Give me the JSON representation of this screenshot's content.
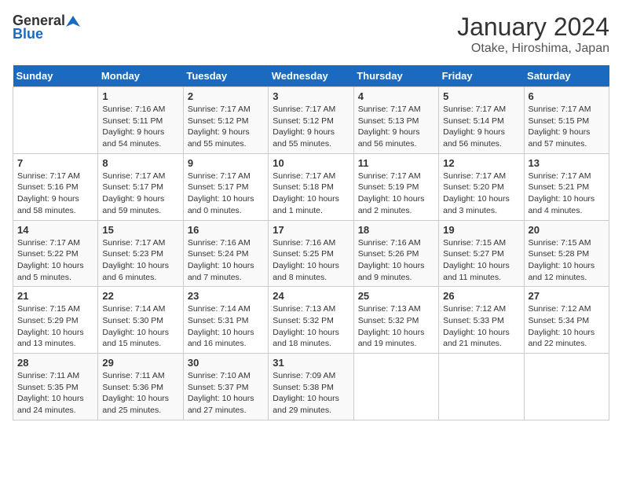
{
  "logo": {
    "general": "General",
    "blue": "Blue"
  },
  "header": {
    "month": "January 2024",
    "location": "Otake, Hiroshima, Japan"
  },
  "days_of_week": [
    "Sunday",
    "Monday",
    "Tuesday",
    "Wednesday",
    "Thursday",
    "Friday",
    "Saturday"
  ],
  "weeks": [
    [
      {
        "day": "",
        "info": ""
      },
      {
        "day": "1",
        "info": "Sunrise: 7:16 AM\nSunset: 5:11 PM\nDaylight: 9 hours\nand 54 minutes."
      },
      {
        "day": "2",
        "info": "Sunrise: 7:17 AM\nSunset: 5:12 PM\nDaylight: 9 hours\nand 55 minutes."
      },
      {
        "day": "3",
        "info": "Sunrise: 7:17 AM\nSunset: 5:12 PM\nDaylight: 9 hours\nand 55 minutes."
      },
      {
        "day": "4",
        "info": "Sunrise: 7:17 AM\nSunset: 5:13 PM\nDaylight: 9 hours\nand 56 minutes."
      },
      {
        "day": "5",
        "info": "Sunrise: 7:17 AM\nSunset: 5:14 PM\nDaylight: 9 hours\nand 56 minutes."
      },
      {
        "day": "6",
        "info": "Sunrise: 7:17 AM\nSunset: 5:15 PM\nDaylight: 9 hours\nand 57 minutes."
      }
    ],
    [
      {
        "day": "7",
        "info": "Sunrise: 7:17 AM\nSunset: 5:16 PM\nDaylight: 9 hours\nand 58 minutes."
      },
      {
        "day": "8",
        "info": "Sunrise: 7:17 AM\nSunset: 5:17 PM\nDaylight: 9 hours\nand 59 minutes."
      },
      {
        "day": "9",
        "info": "Sunrise: 7:17 AM\nSunset: 5:17 PM\nDaylight: 10 hours\nand 0 minutes."
      },
      {
        "day": "10",
        "info": "Sunrise: 7:17 AM\nSunset: 5:18 PM\nDaylight: 10 hours\nand 1 minute."
      },
      {
        "day": "11",
        "info": "Sunrise: 7:17 AM\nSunset: 5:19 PM\nDaylight: 10 hours\nand 2 minutes."
      },
      {
        "day": "12",
        "info": "Sunrise: 7:17 AM\nSunset: 5:20 PM\nDaylight: 10 hours\nand 3 minutes."
      },
      {
        "day": "13",
        "info": "Sunrise: 7:17 AM\nSunset: 5:21 PM\nDaylight: 10 hours\nand 4 minutes."
      }
    ],
    [
      {
        "day": "14",
        "info": "Sunrise: 7:17 AM\nSunset: 5:22 PM\nDaylight: 10 hours\nand 5 minutes."
      },
      {
        "day": "15",
        "info": "Sunrise: 7:17 AM\nSunset: 5:23 PM\nDaylight: 10 hours\nand 6 minutes."
      },
      {
        "day": "16",
        "info": "Sunrise: 7:16 AM\nSunset: 5:24 PM\nDaylight: 10 hours\nand 7 minutes."
      },
      {
        "day": "17",
        "info": "Sunrise: 7:16 AM\nSunset: 5:25 PM\nDaylight: 10 hours\nand 8 minutes."
      },
      {
        "day": "18",
        "info": "Sunrise: 7:16 AM\nSunset: 5:26 PM\nDaylight: 10 hours\nand 9 minutes."
      },
      {
        "day": "19",
        "info": "Sunrise: 7:15 AM\nSunset: 5:27 PM\nDaylight: 10 hours\nand 11 minutes."
      },
      {
        "day": "20",
        "info": "Sunrise: 7:15 AM\nSunset: 5:28 PM\nDaylight: 10 hours\nand 12 minutes."
      }
    ],
    [
      {
        "day": "21",
        "info": "Sunrise: 7:15 AM\nSunset: 5:29 PM\nDaylight: 10 hours\nand 13 minutes."
      },
      {
        "day": "22",
        "info": "Sunrise: 7:14 AM\nSunset: 5:30 PM\nDaylight: 10 hours\nand 15 minutes."
      },
      {
        "day": "23",
        "info": "Sunrise: 7:14 AM\nSunset: 5:31 PM\nDaylight: 10 hours\nand 16 minutes."
      },
      {
        "day": "24",
        "info": "Sunrise: 7:13 AM\nSunset: 5:32 PM\nDaylight: 10 hours\nand 18 minutes."
      },
      {
        "day": "25",
        "info": "Sunrise: 7:13 AM\nSunset: 5:32 PM\nDaylight: 10 hours\nand 19 minutes."
      },
      {
        "day": "26",
        "info": "Sunrise: 7:12 AM\nSunset: 5:33 PM\nDaylight: 10 hours\nand 21 minutes."
      },
      {
        "day": "27",
        "info": "Sunrise: 7:12 AM\nSunset: 5:34 PM\nDaylight: 10 hours\nand 22 minutes."
      }
    ],
    [
      {
        "day": "28",
        "info": "Sunrise: 7:11 AM\nSunset: 5:35 PM\nDaylight: 10 hours\nand 24 minutes."
      },
      {
        "day": "29",
        "info": "Sunrise: 7:11 AM\nSunset: 5:36 PM\nDaylight: 10 hours\nand 25 minutes."
      },
      {
        "day": "30",
        "info": "Sunrise: 7:10 AM\nSunset: 5:37 PM\nDaylight: 10 hours\nand 27 minutes."
      },
      {
        "day": "31",
        "info": "Sunrise: 7:09 AM\nSunset: 5:38 PM\nDaylight: 10 hours\nand 29 minutes."
      },
      {
        "day": "",
        "info": ""
      },
      {
        "day": "",
        "info": ""
      },
      {
        "day": "",
        "info": ""
      }
    ]
  ]
}
